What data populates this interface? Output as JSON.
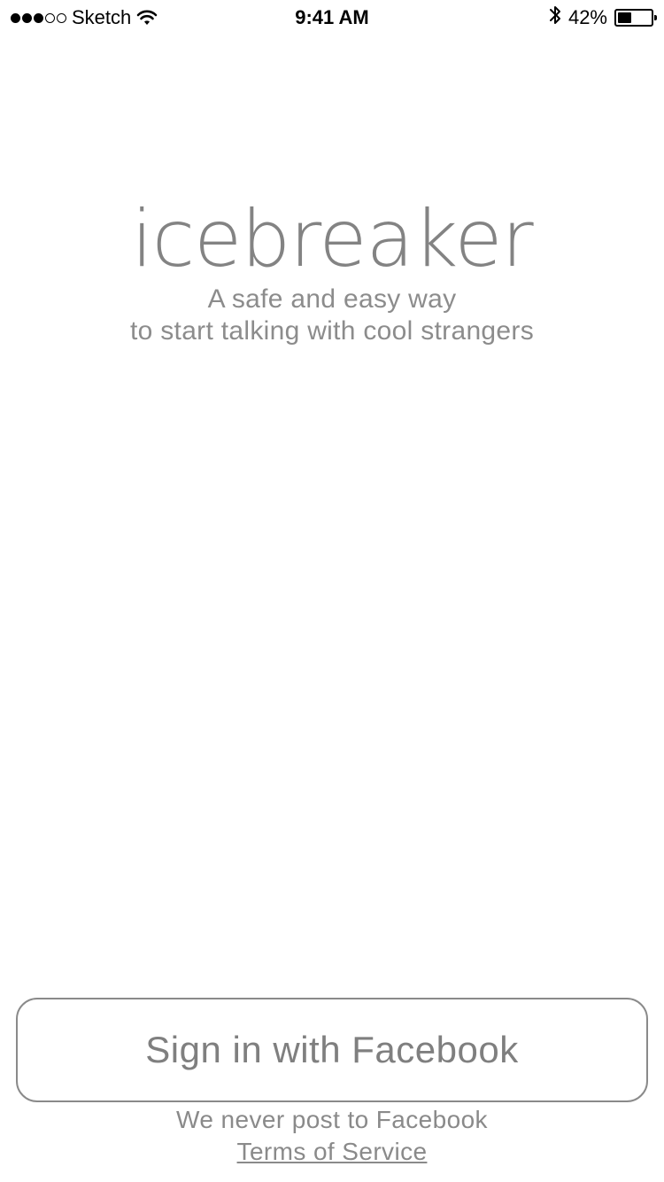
{
  "status_bar": {
    "signal_strength": "3 of 5",
    "carrier": "Sketch",
    "time": "9:41 AM",
    "bluetooth_icon": "bluetooth-icon",
    "battery_percent": "42%",
    "battery_level": 0.42
  },
  "brand": {
    "title": "icebreaker",
    "tagline_line1": "A safe and easy way",
    "tagline_line2": "to start talking with cool strangers"
  },
  "login": {
    "button_label": "Sign in with Facebook",
    "note": "We never post to Facebook",
    "terms_link": "Terms of Service"
  },
  "colors": {
    "text_gray": "#8a8a8a",
    "button_border": "#8a8a8a",
    "background": "#ffffff"
  }
}
